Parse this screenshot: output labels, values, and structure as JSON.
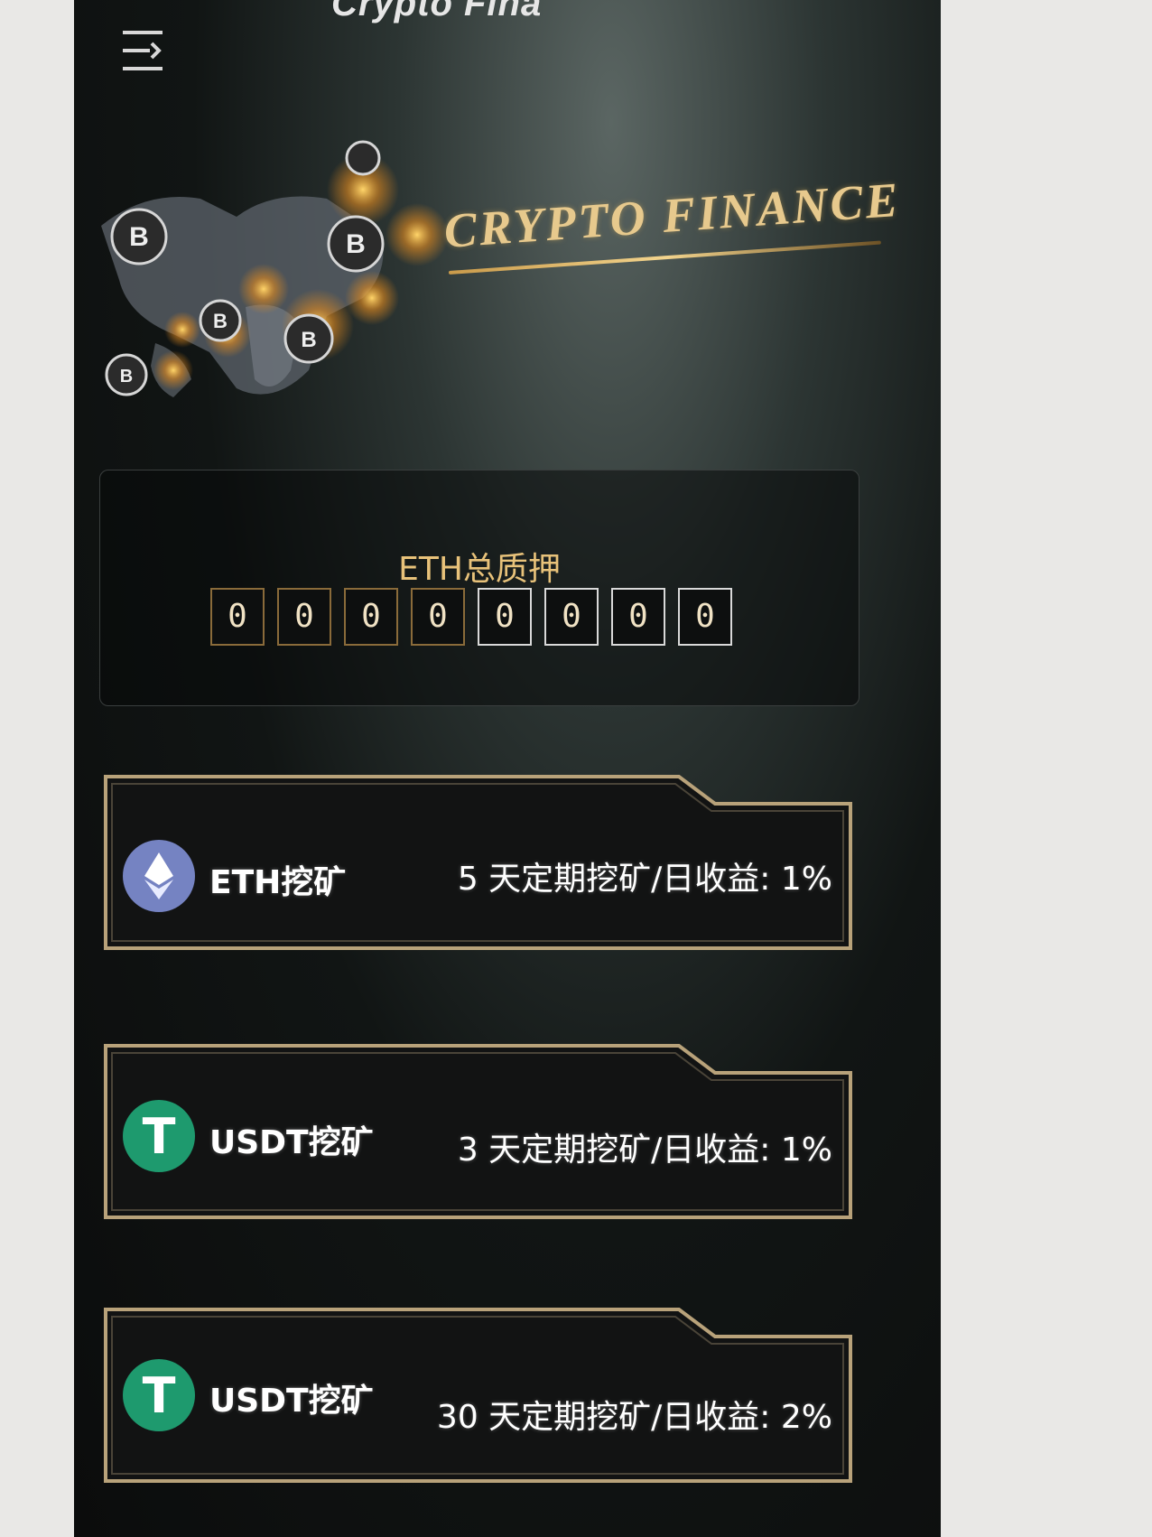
{
  "header": {
    "title": "Crypto Fina"
  },
  "banner": {
    "brand_text": "CRYPTO FINANCE",
    "coin_symbol": "B"
  },
  "staking": {
    "title": "ETH总质押",
    "digits": [
      "0",
      "0",
      "0",
      "0",
      "0",
      "0",
      "0",
      "0"
    ]
  },
  "mining": [
    {
      "name": "ETH挖矿",
      "desc": "5 天定期挖矿/日收益: 1%",
      "icon": "eth-icon"
    },
    {
      "name": "USDT挖矿",
      "desc": "3 天定期挖矿/日收益: 1%",
      "icon": "usdt-icon",
      "symbol": "T"
    },
    {
      "name": "USDT挖矿",
      "desc": "30 天定期挖矿/日收益: 2%",
      "icon": "usdt-icon",
      "symbol": "T"
    }
  ],
  "colors": {
    "accent_gold": "#e8c27a",
    "eth": "#7583c2",
    "usdt": "#1e9a6e"
  }
}
